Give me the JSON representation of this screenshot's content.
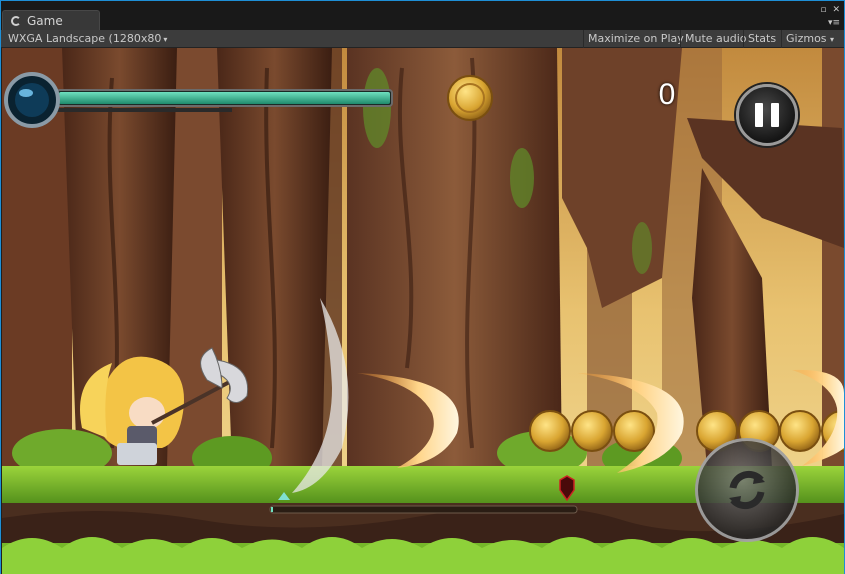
{
  "editor": {
    "tab_label": "Game",
    "resolution_label": "WXGA Landscape (1280x80",
    "maximize_label": "Maximize on Play",
    "mute_label": "Mute audio",
    "stats_label": "Stats",
    "gizmos_label": "Gizmos"
  },
  "hud": {
    "score": "0",
    "health_fraction": 1.0,
    "progress_fraction": 0.0
  },
  "colors": {
    "editor_accent": "#1e8fd6",
    "health_bar": "#3fc4a0",
    "coin": "#d9a531"
  },
  "icons": [
    "unity-icon",
    "pause-icon",
    "swap-icon",
    "coin-icon",
    "enemy-marker-icon"
  ]
}
